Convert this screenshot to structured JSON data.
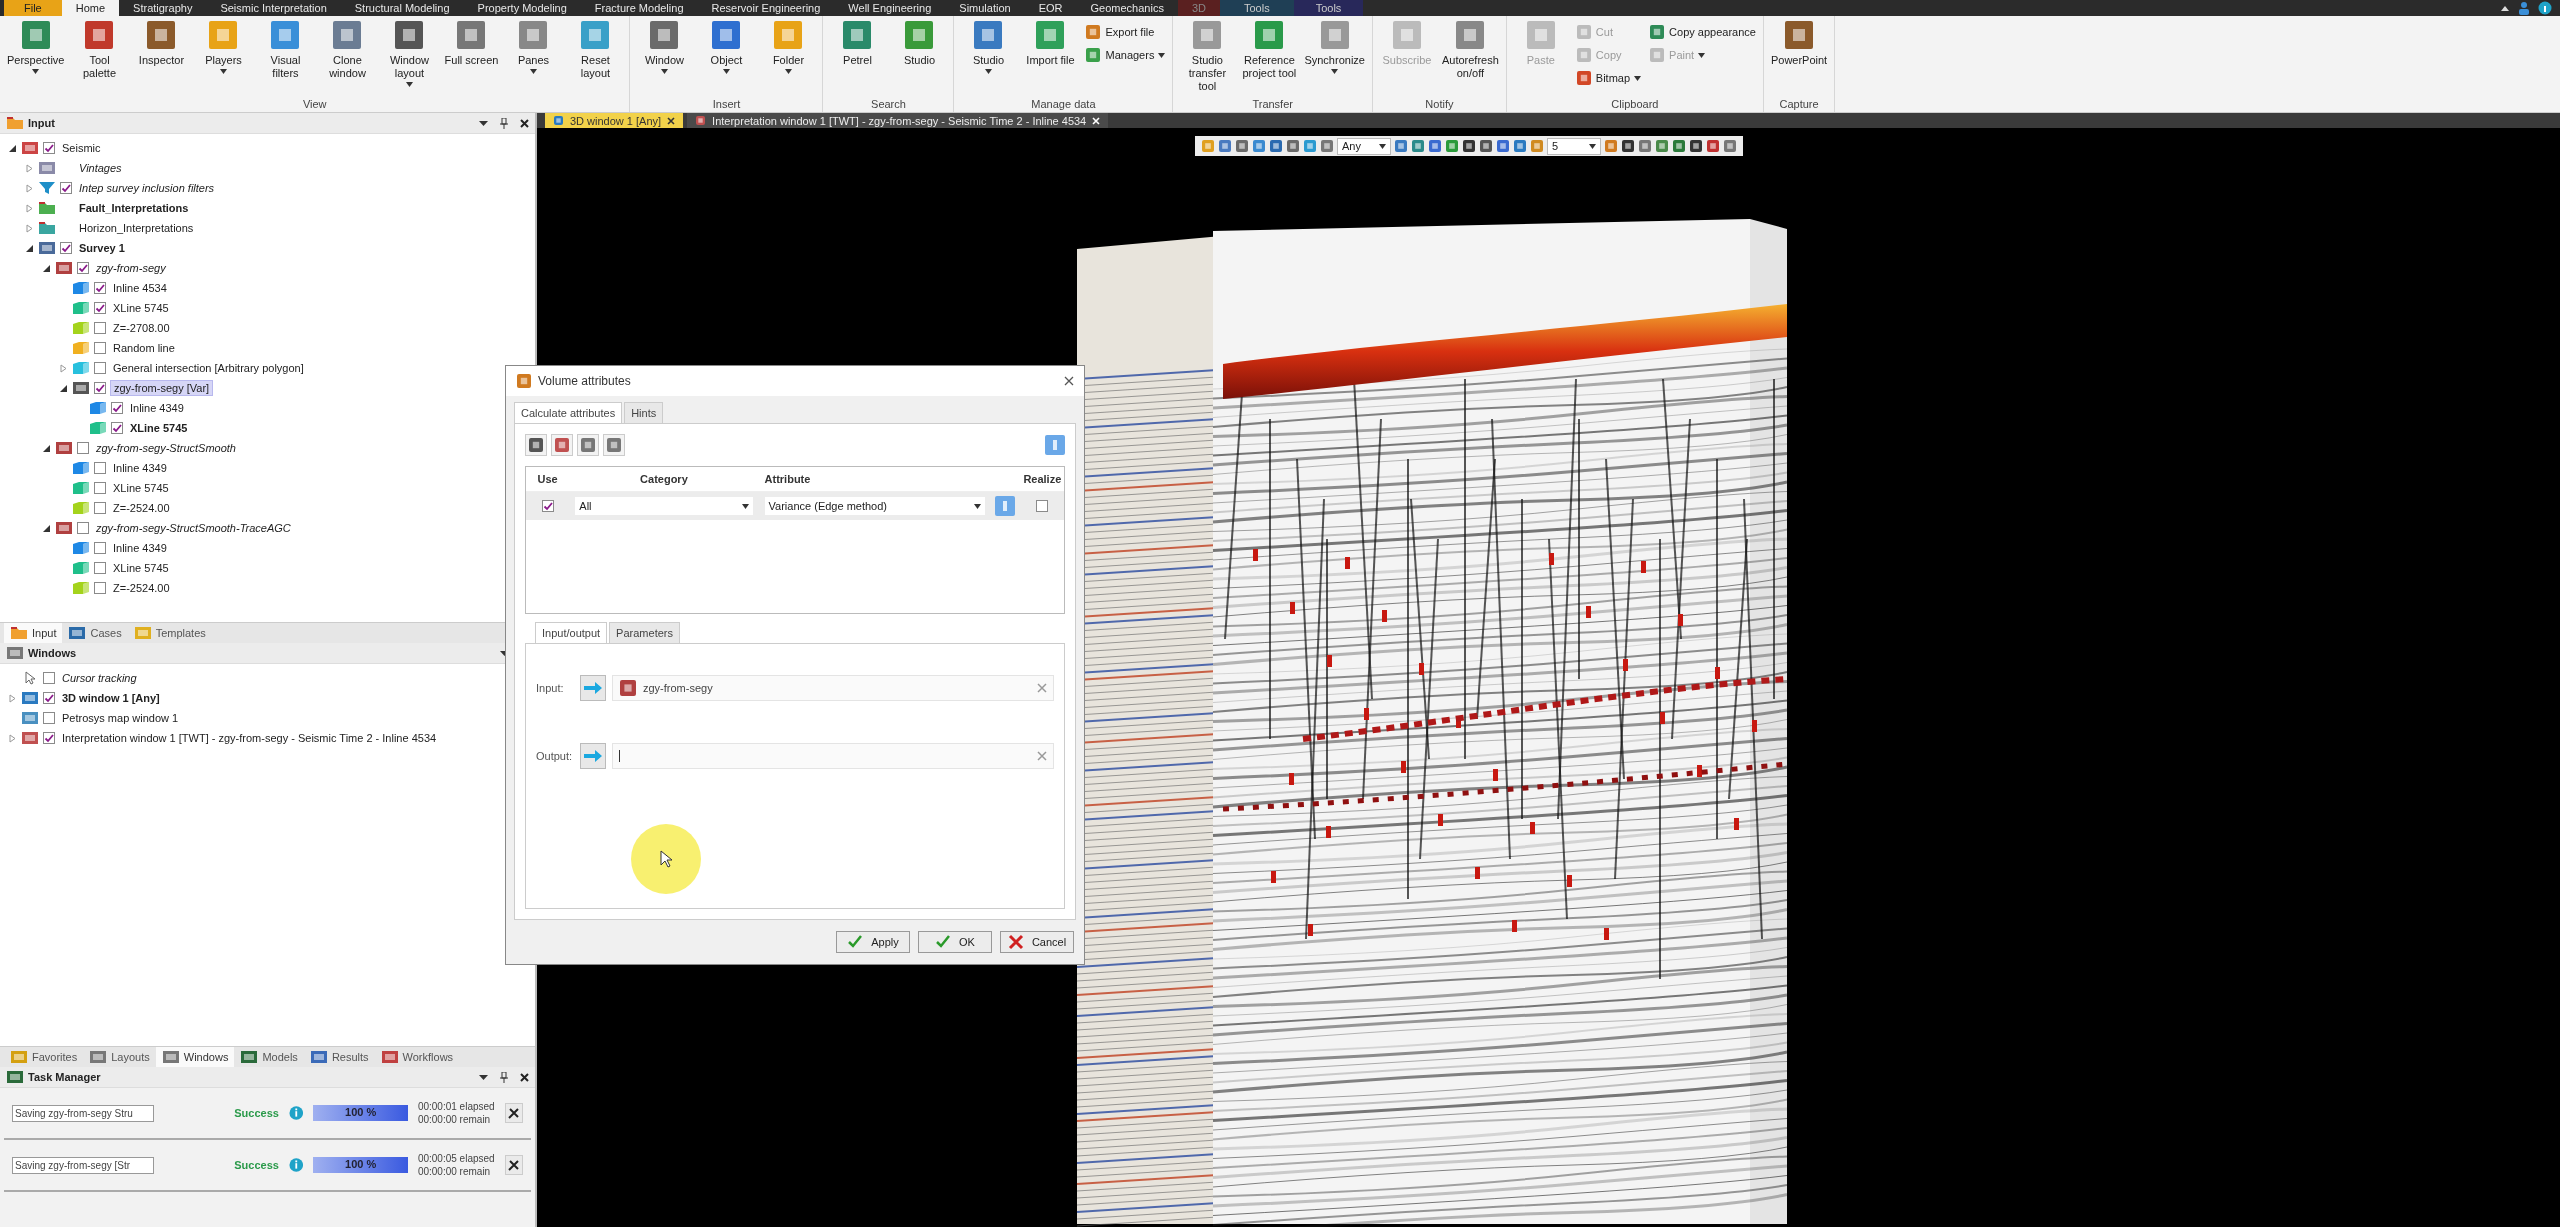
{
  "menu_tabs": [
    {
      "label": "File",
      "kind": "file",
      "selected": false
    },
    {
      "label": "Home",
      "kind": "normal",
      "selected": true
    },
    {
      "label": "Stratigraphy",
      "kind": "normal",
      "selected": false
    },
    {
      "label": "Seismic Interpretation",
      "kind": "normal",
      "selected": false
    },
    {
      "label": "Structural Modeling",
      "kind": "normal",
      "selected": false
    },
    {
      "label": "Property Modeling",
      "kind": "normal",
      "selected": false
    },
    {
      "label": "Fracture Modeling",
      "kind": "normal",
      "selected": false
    },
    {
      "label": "Reservoir Engineering",
      "kind": "normal",
      "selected": false
    },
    {
      "label": "Well Engineering",
      "kind": "normal",
      "selected": false
    },
    {
      "label": "Simulation",
      "kind": "normal",
      "selected": false
    },
    {
      "label": "EOR",
      "kind": "normal",
      "selected": false
    },
    {
      "label": "Geomechanics",
      "kind": "normal",
      "selected": false
    },
    {
      "label": "3D",
      "kind": "red",
      "selected": false
    },
    {
      "label": "Tools",
      "kind": "teal",
      "selected": false
    },
    {
      "label": "Tools",
      "kind": "purple",
      "selected": false
    }
  ],
  "ribbon": {
    "groups": [
      {
        "label": "View",
        "items": [
          {
            "label": "Perspective",
            "kind": "large",
            "dropdown": true,
            "disabled": false
          },
          {
            "label": "Tool palette",
            "kind": "large",
            "dropdown": false,
            "disabled": false
          },
          {
            "label": "Inspector",
            "kind": "large",
            "dropdown": false,
            "disabled": false
          },
          {
            "label": "Players",
            "kind": "large",
            "dropdown": true,
            "disabled": false
          },
          {
            "label": "Visual filters",
            "kind": "large",
            "dropdown": false,
            "disabled": false
          },
          {
            "label": "Clone window",
            "kind": "large",
            "dropdown": false,
            "disabled": false
          },
          {
            "label": "Window layout",
            "kind": "large",
            "dropdown": true,
            "disabled": false
          },
          {
            "label": "Full screen",
            "kind": "large",
            "dropdown": false,
            "disabled": false
          },
          {
            "label": "Panes",
            "kind": "large",
            "dropdown": true,
            "disabled": false
          },
          {
            "label": "Reset layout",
            "kind": "large",
            "dropdown": false,
            "disabled": false
          }
        ]
      },
      {
        "label": "Insert",
        "items": [
          {
            "label": "Window",
            "kind": "large",
            "dropdown": true,
            "disabled": false
          },
          {
            "label": "Object",
            "kind": "large",
            "dropdown": true,
            "disabled": false
          },
          {
            "label": "Folder",
            "kind": "large",
            "dropdown": true,
            "disabled": false
          }
        ]
      },
      {
        "label": "Search",
        "items": [
          {
            "label": "Petrel",
            "kind": "large",
            "dropdown": false,
            "disabled": false
          },
          {
            "label": "Studio",
            "kind": "large",
            "dropdown": false,
            "disabled": false
          }
        ]
      },
      {
        "label": "Manage data",
        "items": [
          {
            "label": "Studio",
            "kind": "large",
            "dropdown": true,
            "disabled": false
          },
          {
            "label": "Import file",
            "kind": "large",
            "dropdown": false,
            "disabled": false
          },
          {
            "label": "Export file",
            "kind": "small",
            "dropdown": false,
            "disabled": false
          },
          {
            "label": "Managers",
            "kind": "small",
            "dropdown": true,
            "disabled": false
          }
        ]
      },
      {
        "label": "Transfer",
        "items": [
          {
            "label": "Studio transfer tool",
            "kind": "large",
            "dropdown": false,
            "disabled": false
          },
          {
            "label": "Reference project tool",
            "kind": "large",
            "dropdown": false,
            "disabled": false
          },
          {
            "label": "Synchronize",
            "kind": "large",
            "dropdown": true,
            "disabled": false
          }
        ]
      },
      {
        "label": "Notify",
        "items": [
          {
            "label": "Subscribe",
            "kind": "large",
            "dropdown": false,
            "disabled": true
          },
          {
            "label": "Autorefresh on/off",
            "kind": "large",
            "dropdown": false,
            "disabled": false
          }
        ]
      },
      {
        "label": "Clipboard",
        "items": [
          {
            "label": "Paste",
            "kind": "large",
            "dropdown": false,
            "disabled": true
          },
          {
            "label": "Cut",
            "kind": "small",
            "dropdown": false,
            "disabled": true
          },
          {
            "label": "Copy",
            "kind": "small",
            "dropdown": false,
            "disabled": true
          },
          {
            "label": "Bitmap",
            "kind": "small",
            "dropdown": true,
            "disabled": false
          },
          {
            "label": "Copy appearance",
            "kind": "small",
            "dropdown": false,
            "disabled": false
          },
          {
            "label": "Paint",
            "kind": "small",
            "dropdown": true,
            "disabled": true
          }
        ]
      },
      {
        "label": "Capture",
        "items": [
          {
            "label": "PowerPoint",
            "kind": "large",
            "dropdown": false,
            "disabled": false
          }
        ]
      }
    ]
  },
  "input_panel": {
    "title": "Input",
    "tree": [
      {
        "label": "Seismic",
        "kind": "seismic",
        "checked": true,
        "expanded": true,
        "children": [
          {
            "label": "Vintages",
            "kind": "vintage",
            "expanded": false,
            "italic": true
          },
          {
            "label": "Intep survey inclusion filters",
            "kind": "filter",
            "checked": true,
            "expanded": false,
            "italic": true
          },
          {
            "label": "Fault_Interpretations",
            "kind": "folder-green",
            "expanded": false,
            "bold": true
          },
          {
            "label": "Horizon_Interpretations",
            "kind": "folder-teal",
            "expanded": false
          },
          {
            "label": "Survey 1",
            "kind": "survey",
            "checked": true,
            "expanded": true,
            "bold": true,
            "children": [
              {
                "label": "zgy-from-segy",
                "kind": "cube",
                "checked": true,
                "expanded": true,
                "italic": true,
                "children": [
                  {
                    "label": "Inline 4534",
                    "kind": "inline",
                    "checked": true
                  },
                  {
                    "label": "XLine 5745",
                    "kind": "xline",
                    "checked": true
                  },
                  {
                    "label": "Z=-2708.00",
                    "kind": "zslice",
                    "checked": false
                  },
                  {
                    "label": "Random line",
                    "kind": "random",
                    "checked": false
                  },
                  {
                    "label": "General intersection [Arbitrary polygon]",
                    "kind": "intersection",
                    "checked": false,
                    "expanded": false
                  },
                  {
                    "label": "zgy-from-segy [Var]",
                    "kind": "virtual",
                    "checked": true,
                    "expanded": true,
                    "selected": true,
                    "children": [
                      {
                        "label": "Inline 4349",
                        "kind": "inline",
                        "checked": true
                      },
                      {
                        "label": "XLine 5745",
                        "kind": "xline",
                        "checked": true,
                        "bold": true
                      }
                    ]
                  }
                ]
              },
              {
                "label": "zgy-from-segy-StructSmooth",
                "kind": "cube",
                "checked": false,
                "expanded": true,
                "italic": true,
                "children": [
                  {
                    "label": "Inline 4349",
                    "kind": "inline",
                    "checked": false
                  },
                  {
                    "label": "XLine 5745",
                    "kind": "xline",
                    "checked": false
                  },
                  {
                    "label": "Z=-2524.00",
                    "kind": "zslice",
                    "checked": false
                  }
                ]
              },
              {
                "label": "zgy-from-segy-StructSmooth-TraceAGC",
                "kind": "cube",
                "checked": false,
                "expanded": true,
                "italic": true,
                "children": [
                  {
                    "label": "Inline 4349",
                    "kind": "inline",
                    "checked": false
                  },
                  {
                    "label": "XLine 5745",
                    "kind": "xline",
                    "checked": false
                  },
                  {
                    "label": "Z=-2524.00",
                    "kind": "zslice",
                    "checked": false
                  }
                ]
              }
            ]
          }
        ]
      }
    ],
    "tabs": [
      {
        "label": "Input",
        "kind": "folder",
        "selected": true
      },
      {
        "label": "Cases",
        "kind": "cases",
        "selected": false
      },
      {
        "label": "Templates",
        "kind": "templates",
        "selected": false
      }
    ]
  },
  "windows_panel": {
    "title": "Windows",
    "items": [
      {
        "label": "Cursor tracking",
        "kind": "cursor",
        "checked": false,
        "italic": true
      },
      {
        "label": "3D window 1 [Any]",
        "kind": "window3d",
        "checked": true,
        "expanded": false,
        "bold": true
      },
      {
        "label": "Petrosys map window 1",
        "kind": "map",
        "checked": false
      },
      {
        "label": "Interpretation window 1 [TWT] - zgy-from-segy - Seismic Time 2 - Inline 4534",
        "kind": "interp",
        "checked": true,
        "expanded": false
      }
    ],
    "tabs": [
      {
        "label": "Favorites",
        "kind": "favorites",
        "selected": false
      },
      {
        "label": "Layouts",
        "kind": "layouts",
        "selected": false
      },
      {
        "label": "Windows",
        "kind": "windows",
        "selected": true
      },
      {
        "label": "Models",
        "kind": "models",
        "selected": false
      },
      {
        "label": "Results",
        "kind": "results",
        "selected": false
      },
      {
        "label": "Workflows",
        "kind": "workflows",
        "selected": false
      }
    ]
  },
  "task_manager": {
    "title": "Task Manager",
    "tasks": [
      {
        "name": "Saving zgy-from-segy Stru",
        "status": "Success",
        "progress": "100 %",
        "level": 1,
        "elapsed": "00:00:01 elapsed",
        "remain": "00:00:00 remain"
      },
      {
        "name": "Saving zgy-from-segy [Str",
        "status": "Success",
        "progress": "100 %",
        "level": 1,
        "elapsed": "00:00:05 elapsed",
        "remain": "00:00:00 remain"
      }
    ]
  },
  "document_tabs": [
    {
      "label": "3D window 1 [Any]",
      "selected": true
    },
    {
      "label": "Interpretation window 1 [TWT] - zgy-from-segy - Seismic Time 2 - Inline 4534",
      "selected": false
    }
  ],
  "viewer_toolbar": {
    "dropdowns": [
      {
        "value": "Any"
      },
      {
        "value": "5"
      }
    ]
  },
  "dialog": {
    "title": "Volume attributes",
    "tabs": [
      {
        "label": "Calculate attributes",
        "selected": true
      },
      {
        "label": "Hints",
        "selected": false
      }
    ],
    "table": {
      "columns": [
        "Use",
        "Category",
        "Attribute",
        "Realize"
      ],
      "rows": [
        {
          "use": true,
          "category": "All",
          "attribute": "Variance (Edge method)",
          "realize": false
        }
      ]
    },
    "subtabs": [
      {
        "label": "Input/output",
        "selected": true
      },
      {
        "label": "Parameters",
        "selected": false
      }
    ],
    "input": {
      "label": "Input:",
      "value": "zgy-from-segy"
    },
    "output": {
      "label": "Output:"
    },
    "buttons": [
      {
        "label": "Apply",
        "kind": "apply"
      },
      {
        "label": "OK",
        "kind": "ok"
      },
      {
        "label": "Cancel",
        "kind": "cancel"
      }
    ]
  }
}
